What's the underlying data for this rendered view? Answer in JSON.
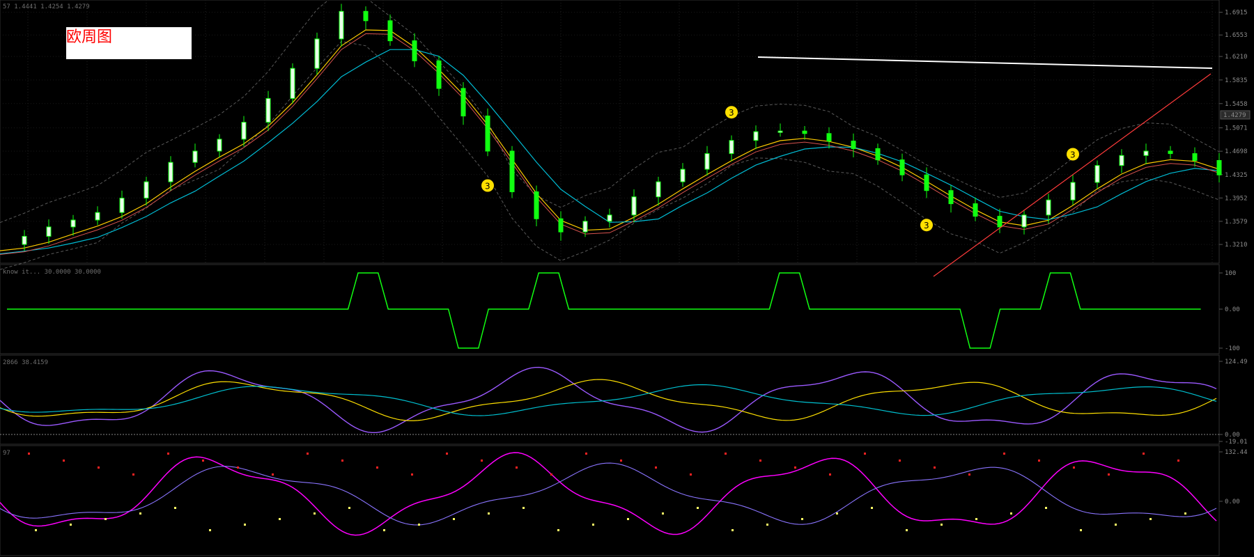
{
  "chart_annotation": {
    "label": "欧周图"
  },
  "header_text": "57 1.4441 1.4254 1.4279",
  "panels": {
    "price": {
      "y_ticks": [
        "1.6915",
        "1.6553",
        "1.6210",
        "1.5835",
        "1.5458",
        "1.5071",
        "1.4698",
        "1.4325",
        "1.3952",
        "1.3579",
        "1.3210"
      ],
      "current_price": "1.4279"
    },
    "indicator1": {
      "legend": "know it... 30.0000 30.0000",
      "y_ticks": [
        "100",
        "0.00",
        "-100"
      ]
    },
    "indicator2": {
      "legend": "2866 38.4159",
      "y_ticks": [
        "124.49",
        "0.00",
        "-19.01"
      ]
    },
    "indicator3": {
      "legend": "97",
      "y_ticks": [
        "132.44",
        "0.00"
      ]
    }
  },
  "chart_data": [
    {
      "type": "line",
      "title": "",
      "series": [
        {
          "name": "",
          "x": [
            0,
            1,
            2,
            3,
            4,
            5,
            6,
            7,
            8,
            9,
            10,
            11,
            12,
            13,
            14,
            15,
            16,
            17,
            18,
            19,
            20,
            21,
            22,
            23,
            24,
            25,
            26,
            27,
            28,
            29,
            30,
            31,
            32,
            33,
            34,
            35,
            36,
            37,
            38,
            39,
            40,
            41,
            42,
            43,
            44,
            45,
            46,
            47,
            48,
            49,
            50
          ],
          "values": [
            1.321,
            1.334,
            1.349,
            1.36,
            1.372,
            1.395,
            1.421,
            1.452,
            1.47,
            1.489,
            1.516,
            1.554,
            1.602,
            1.649,
            1.693,
            1.678,
            1.646,
            1.614,
            1.57,
            1.526,
            1.47,
            1.405,
            1.362,
            1.341,
            1.358,
            1.368,
            1.397,
            1.421,
            1.441,
            1.466,
            1.487,
            1.501,
            1.502,
            1.498,
            1.486,
            1.474,
            1.456,
            1.432,
            1.407,
            1.386,
            1.366,
            1.349,
            1.368,
            1.392,
            1.42,
            1.447,
            1.463,
            1.47,
            1.466,
            1.455,
            1.432
          ]
        }
      ]
    }
  ]
}
